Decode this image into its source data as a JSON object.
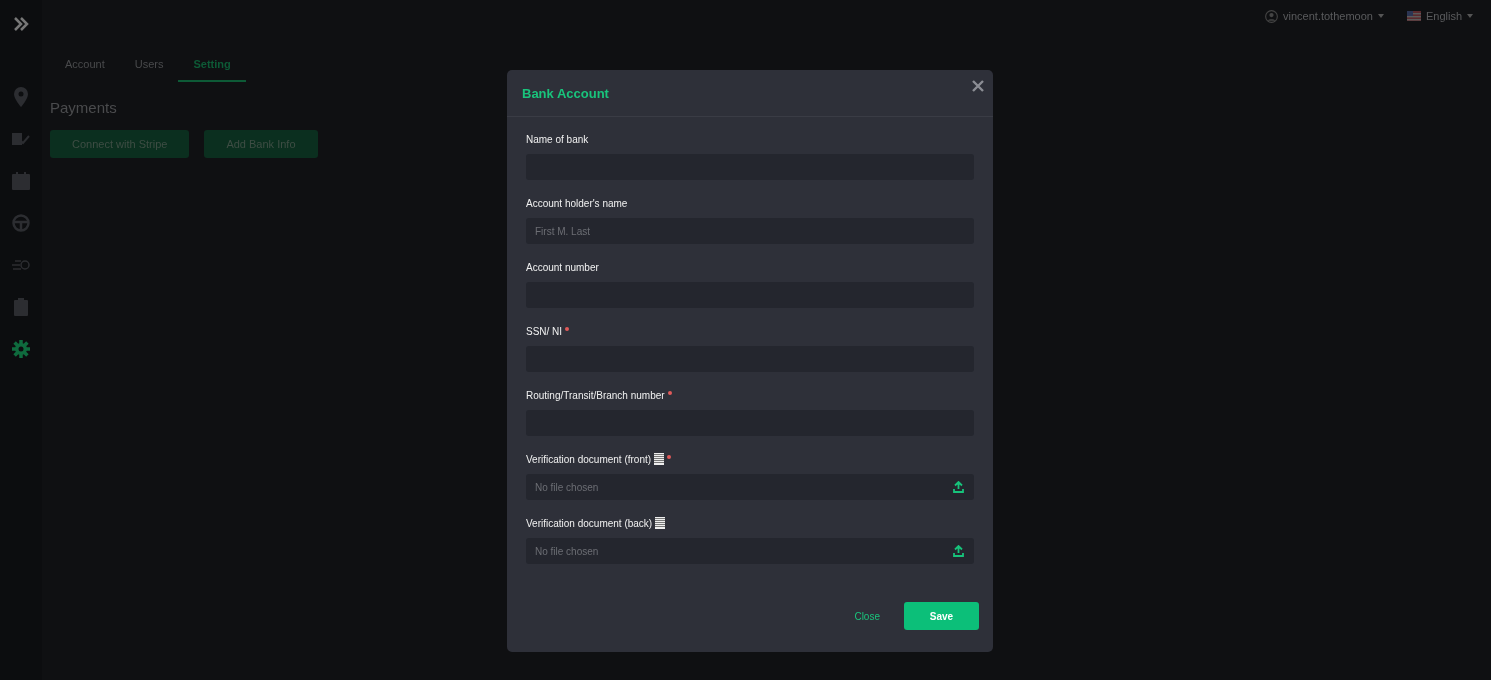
{
  "sidebar": {
    "items": [
      {
        "selected": false
      },
      {
        "selected": false
      },
      {
        "selected": false
      },
      {
        "selected": false
      },
      {
        "selected": false
      },
      {
        "selected": false
      },
      {
        "selected": true
      }
    ]
  },
  "top_bar": {
    "user": "vincent.tothemoon",
    "language": "English"
  },
  "tabs": [
    {
      "label": "Account",
      "selected": false
    },
    {
      "label": "Users",
      "selected": false
    },
    {
      "label": "Setting",
      "selected": true
    }
  ],
  "section_title": "Payments",
  "section_buttons": [
    "Connect with Stripe",
    "Add Bank Info"
  ],
  "dialog": {
    "title": "Bank Account",
    "fields": [
      {
        "kind": "text",
        "label": "Name of bank",
        "required": false,
        "doc_icon": false
      },
      {
        "kind": "text",
        "label": "Account holder's name",
        "placeholder": "First M. Last",
        "required": false,
        "doc_icon": false
      },
      {
        "kind": "text",
        "label": "Account number",
        "required": false,
        "doc_icon": false
      },
      {
        "kind": "text",
        "label": "SSN/ NI",
        "required": true,
        "doc_icon": false
      },
      {
        "kind": "text",
        "label": "Routing/Transit/Branch number",
        "required": true,
        "doc_icon": false
      },
      {
        "kind": "file",
        "label": "Verification document (front)",
        "value": "No file chosen",
        "required": true,
        "doc_icon": true
      },
      {
        "kind": "file",
        "label": "Verification document (back)",
        "value": "No file chosen",
        "required": false,
        "doc_icon": true
      }
    ],
    "buttons": [
      {
        "label": "Close",
        "kind": "link"
      },
      {
        "label": "Save",
        "kind": "primary"
      }
    ]
  }
}
